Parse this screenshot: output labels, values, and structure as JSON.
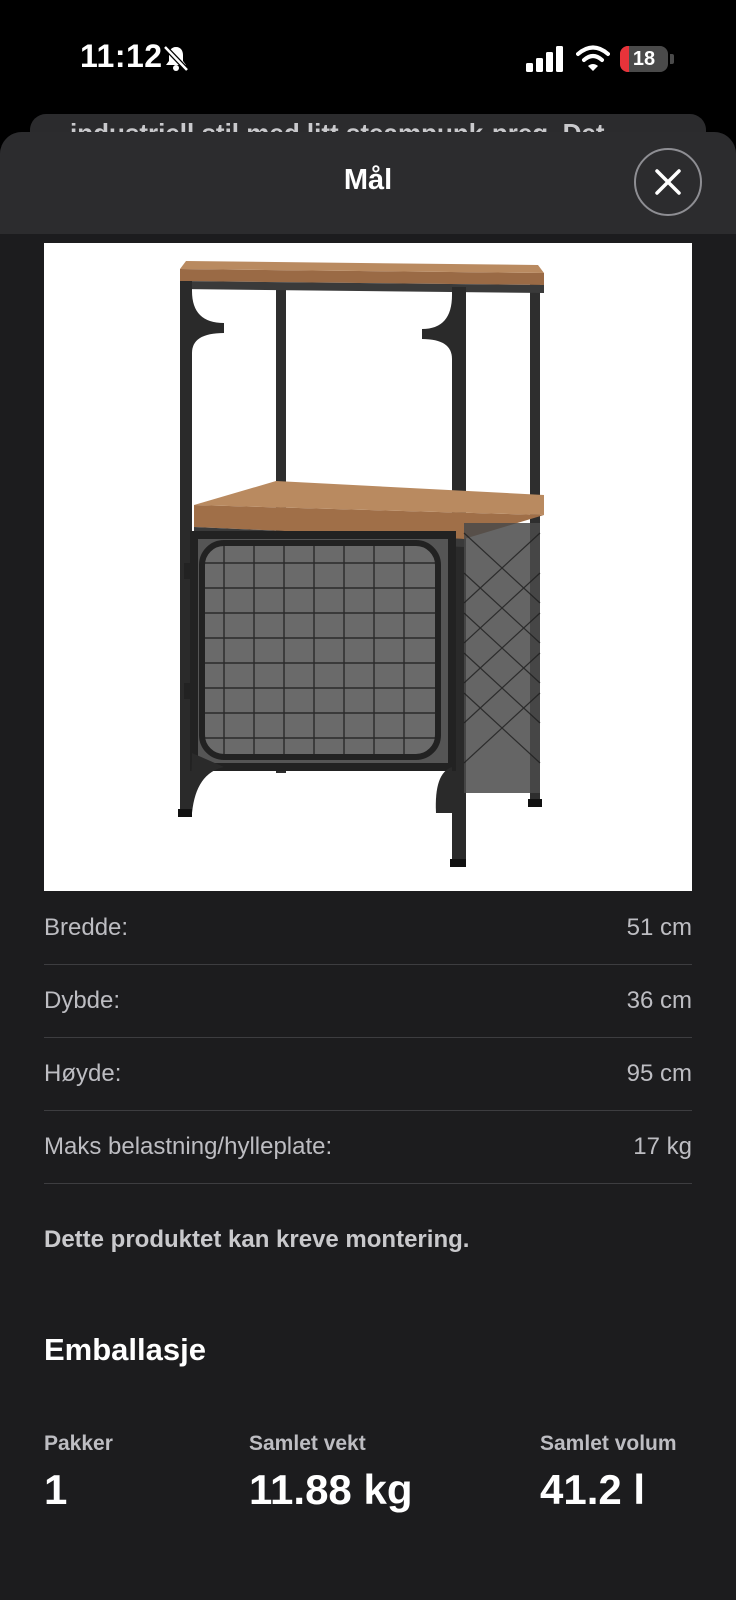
{
  "status_bar": {
    "time": "11:12",
    "battery_level": "18",
    "battery_fraction": 0.18
  },
  "background_sheet": {
    "text": "industriell stil med litt steampunk-preg. Det"
  },
  "sheet": {
    "title": "Mål",
    "close_icon": "close-icon",
    "image_subject": "shelf-unit-with-mesh-door-photo"
  },
  "specs": [
    {
      "label": "Bredde:",
      "value": "51 cm"
    },
    {
      "label": "Dybde:",
      "value": "36 cm"
    },
    {
      "label": "Høyde:",
      "value": "95 cm"
    },
    {
      "label": "Maks belastning/hylleplate:",
      "value": "17 kg"
    }
  ],
  "assembly_note": "Dette produktet kan kreve montering.",
  "packaging": {
    "heading": "Emballasje",
    "items": [
      {
        "label": "Pakker",
        "value": "1"
      },
      {
        "label": "Samlet vekt",
        "value": "11.88 kg"
      },
      {
        "label": "Samlet volum",
        "value": "41.2 l"
      }
    ]
  },
  "colors": {
    "sheet_background": "#1c1c1e",
    "header_background": "#2c2c2e",
    "battery_low": "#e8333a"
  }
}
